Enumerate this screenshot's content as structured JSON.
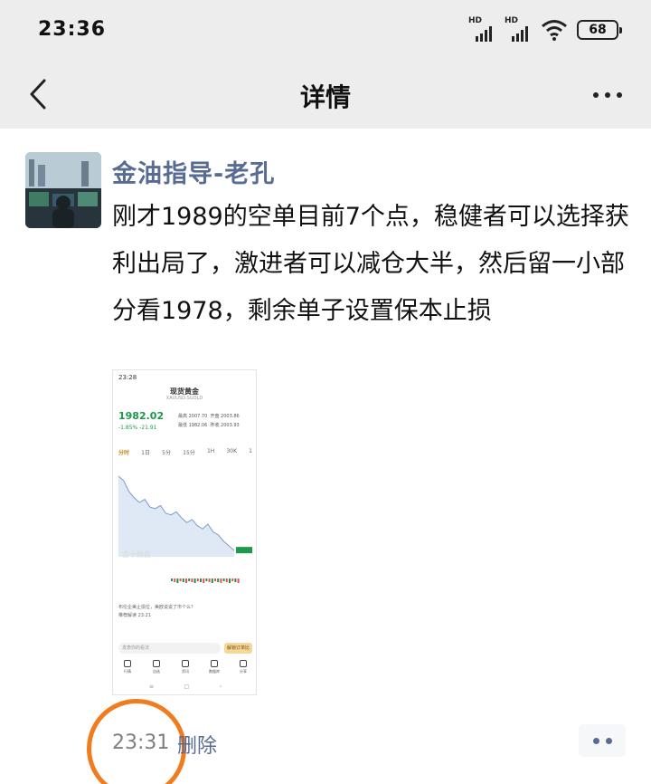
{
  "status_bar": {
    "time": "23:36",
    "signal_label": "HD",
    "battery": "68",
    "icons": [
      "hd-signal-icon",
      "hd-signal-icon",
      "wifi-icon",
      "battery-icon"
    ]
  },
  "nav": {
    "title": "详情",
    "back_icon": "chevron-left-icon",
    "more_icon": "more-icon"
  },
  "post": {
    "author": "金油指导-老孔",
    "text": "刚才1989的空单目前7个点，稳健者可以选择获利出局了，激进者可以减仓大半，然后留一小部分看1978，剩余单子设置保本止损",
    "time": "23:31",
    "delete_label": "删除",
    "comment_icon": "comment-icon"
  },
  "embedded_screenshot": {
    "time": "23:28",
    "title": "现货黄金",
    "subtitle": "XAUUSD.SGOLD",
    "price": "1982.02",
    "change": "-1.85% -21.91",
    "stats": [
      "最高 2007.70",
      "开盘 2003.86",
      "最低 1982.06",
      "昨收 2003.93"
    ],
    "tabs": [
      "分时",
      "1日",
      "5分",
      "15分",
      "1H",
      "30K",
      "1"
    ],
    "active_tab": "分时",
    "watermark": "金十数据",
    "news": [
      "布伦企美止损位，美欧说说了市个么？",
      "推荐解读 23:21"
    ],
    "input_placeholder": "发表你的看法",
    "input_button": "解锁订单比",
    "bottom_nav": [
      "行情",
      "自选",
      "资讯",
      "数据库",
      "分享"
    ],
    "home_bar": [
      "≡",
      "□",
      "‹"
    ]
  },
  "chart_data": {
    "type": "line",
    "title": "现货黄金",
    "ylim": [
      1980,
      2008
    ],
    "series": [
      {
        "values": [
          2006.0,
          2004.5,
          2001.0,
          1999.0,
          1997.5,
          1998.5,
          1996.0,
          1995.5,
          1996.5,
          1994.0,
          1993.5,
          1994.5,
          1992.5,
          1991.0,
          1992.0,
          1990.0,
          1989.0,
          1990.5,
          1988.0,
          1987.0,
          1985.0,
          1983.5,
          1982.0
        ]
      }
    ]
  },
  "colors": {
    "link": "#576b95",
    "annotation_circle": "#f07c1e",
    "price_green": "#1a9a4a"
  }
}
